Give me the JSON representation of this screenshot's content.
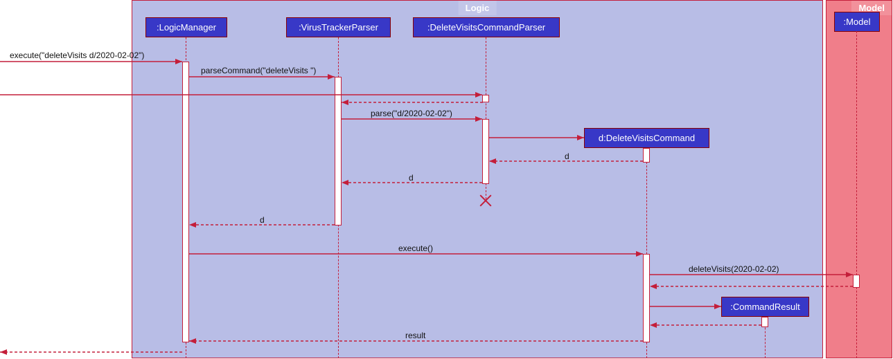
{
  "boxes": {
    "logic": "Logic",
    "model": "Model"
  },
  "participants": {
    "logicManager": ":LogicManager",
    "virusTrackerParser": ":VirusTrackerParser",
    "deleteVisitsCommandParser": ":DeleteVisitsCommandParser",
    "deleteVisitsCommand": "d:DeleteVisitsCommand",
    "commandResult": ":CommandResult",
    "model": ":Model"
  },
  "messages": {
    "execute": "execute(\"deleteVisits d/2020-02-02\")",
    "parseCommand": "parseCommand(\"deleteVisits \")",
    "parse": "parse(\"d/2020-02-02\")",
    "returnD1": "d",
    "returnD2": "d",
    "returnD3": "d",
    "executeCall": "execute()",
    "deleteVisits": "deleteVisits(2020-02-02)",
    "result": "result"
  }
}
